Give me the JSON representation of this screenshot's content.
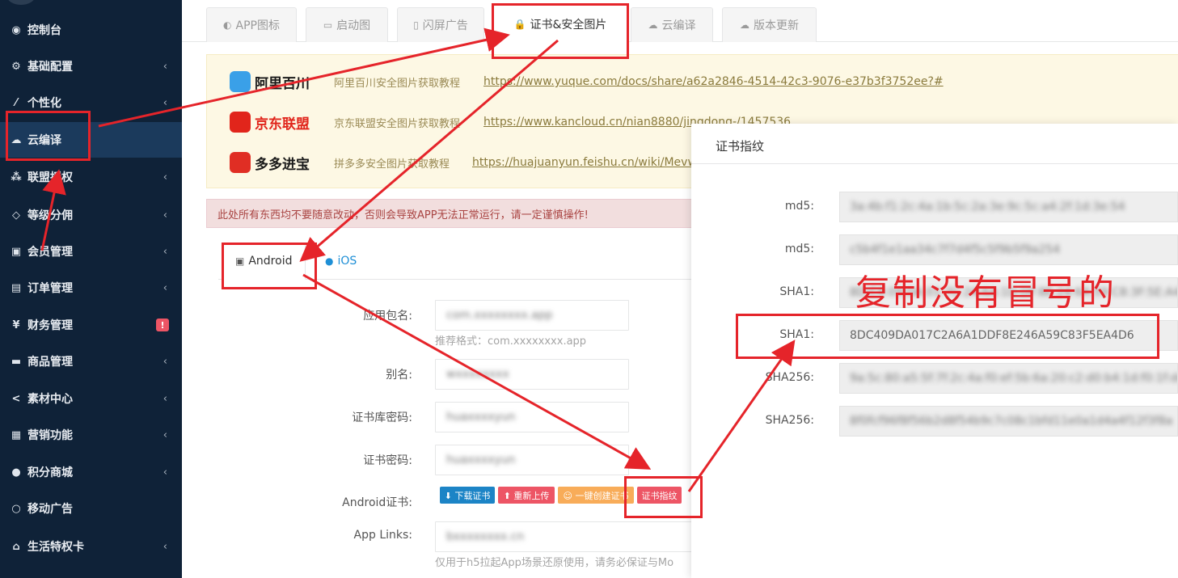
{
  "sidebar": {
    "items": [
      {
        "label": "控制台",
        "icon": "dashboard-icon",
        "glyph": "◉",
        "chevron": false
      },
      {
        "label": "基础配置",
        "icon": "cogs-icon",
        "glyph": "⚙",
        "chevron": true
      },
      {
        "label": "个性化",
        "icon": "magic-icon",
        "glyph": "⁄",
        "chevron": true
      },
      {
        "label": "云编译",
        "icon": "cloud-icon",
        "glyph": "☁",
        "chevron": false,
        "active": true
      },
      {
        "label": "联盟授权",
        "icon": "users-icon",
        "glyph": "⁂",
        "chevron": true
      },
      {
        "label": "等级分佣",
        "icon": "diamond-icon",
        "glyph": "◇",
        "chevron": true
      },
      {
        "label": "会员管理",
        "icon": "user-card-icon",
        "glyph": "▣",
        "chevron": true
      },
      {
        "label": "订单管理",
        "icon": "copy-icon",
        "glyph": "▤",
        "chevron": true
      },
      {
        "label": "财务管理",
        "icon": "yen-icon",
        "glyph": "¥",
        "chevron": false,
        "badge": "!"
      },
      {
        "label": "商品管理",
        "icon": "briefcase-icon",
        "glyph": "▬",
        "chevron": true
      },
      {
        "label": "素材中心",
        "icon": "share-icon",
        "glyph": "<",
        "chevron": true
      },
      {
        "label": "营销功能",
        "icon": "gift-icon",
        "glyph": "▦",
        "chevron": true
      },
      {
        "label": "积分商城",
        "icon": "circle-icon",
        "glyph": "●",
        "chevron": true
      },
      {
        "label": "移动广告",
        "icon": "ring-icon",
        "glyph": "○",
        "chevron": false
      },
      {
        "label": "生活特权卡",
        "icon": "bank-icon",
        "glyph": "⌂",
        "chevron": true
      }
    ],
    "chevron_glyph": "‹"
  },
  "tabs": [
    {
      "label": "APP图标",
      "icon": "adjust-icon",
      "glyph": "◐"
    },
    {
      "label": "启动图",
      "icon": "image-icon",
      "glyph": "▭"
    },
    {
      "label": "闪屏广告",
      "icon": "file-icon",
      "glyph": "▯"
    },
    {
      "label": "证书&安全图片",
      "icon": "lock-icon",
      "glyph": "🔒",
      "active": true
    },
    {
      "label": "云编译",
      "icon": "cloud-icon",
      "glyph": "☁"
    },
    {
      "label": "版本更新",
      "icon": "cloud-upload-icon",
      "glyph": "☁"
    }
  ],
  "links": [
    {
      "brand": "阿里百川",
      "brand_color": "#1a1a1a",
      "logo_color": "#3aa0e8",
      "desc": "阿里百川安全图片获取教程",
      "url": "https://www.yuque.com/docs/share/a62a2846-4514-42c3-9076-e37b3f3752ee?#"
    },
    {
      "brand": "京东联盟",
      "brand_color": "#e1251b",
      "logo_color": "#e1251b",
      "desc": "京东联盟安全图片获取教程",
      "url": "https://www.kancloud.cn/nian8880/jingdong-/1457536"
    },
    {
      "brand": "多多进宝",
      "brand_color": "#1a1a1a",
      "logo_color": "#e02e24",
      "desc": "拼多多安全图片获取教程",
      "url": "https://huajuanyun.feishu.cn/wiki/Mevw"
    }
  ],
  "alert": "此处所有东西均不要随意改动，否则会导致APP无法正常运行，请一定谨慎操作!",
  "os_tabs": {
    "android": "Android",
    "ios": "iOS"
  },
  "form": {
    "package_label": "应用包名:",
    "package_value": "com.xxxxxxxx.app",
    "package_help": "推荐格式：com.xxxxxxxx.app",
    "alias_label": "别名:",
    "alias_value": "wxxxxxxxx",
    "keystore_pwd_label": "证书库密码:",
    "keystore_pwd_value": "huaxxxxyun",
    "cert_pwd_label": "证书密码:",
    "cert_pwd_value": "huaxxxxyun",
    "android_cert_label": "Android证书:",
    "applinks_label": "App Links:",
    "applinks_value": "bxxxxxxxx.cn",
    "applinks_help": "仅用于h5拉起App场景还原使用，请务必保证与Mo"
  },
  "cert_buttons": [
    {
      "label": "⬇ 下载证书",
      "color": "#1c84c6"
    },
    {
      "label": "⬆ 重新上传",
      "color": "#ed5565"
    },
    {
      "label": "☺ 一键创建证书",
      "color": "#f8ac59"
    },
    {
      "label": "证书指纹",
      "color": "#ed5565"
    }
  ],
  "modal": {
    "title": "证书指纹",
    "rows": [
      {
        "label": "md5:",
        "value": "3a:4b:f1:2c:4a:1b:5c:2a:3e:9c:5c:a4:2f:1d:3e:54",
        "blurred": true
      },
      {
        "label": "md5:",
        "value": "c5b4f1e1aa34c7f7d4f5c5f9b5f9a254",
        "blurred": true
      },
      {
        "label": "SHA1:",
        "value": "8D:C4:09:DA:01:7C:2A:6A:1D:DF:8E:24:6A:59:C8:3F:5E:A4:D6",
        "blurred": true
      },
      {
        "label": "SHA1:",
        "value": "8DC409DA017C2A6A1DDF8E246A59C83F5EA4D6",
        "blurred": false
      },
      {
        "label": "SHA256:",
        "value": "9a:5c:80:a5:5f:7f:2c:4a:f0:ef:5b:6a:20:c2:d0:b4:1d:f0:1f:de:1a:4f",
        "blurred": true
      },
      {
        "label": "SHA256:",
        "value": "8f0fcf96f8f56b2d8f54b9c7c08c1bfd11e0a1d4a4f12f3f8a",
        "blurred": true
      }
    ]
  },
  "callout": "复制没有冒号的"
}
